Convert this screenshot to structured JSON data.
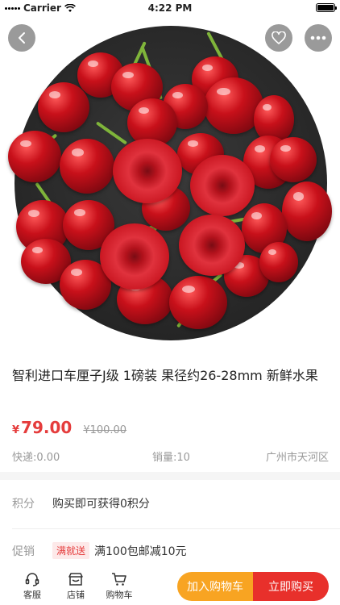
{
  "status_bar": {
    "carrier": "Carrier",
    "time": "4:22 PM"
  },
  "hero": {
    "icons": [
      "back-icon",
      "heart-icon",
      "more-icon"
    ]
  },
  "product": {
    "title": "智利进口车厘子J级 1磅装 果径约26-28mm 新鲜水果",
    "currency": "¥",
    "price": "79.00",
    "original_price": "¥100.00",
    "shipping": "快递:0.00",
    "sales": "销量:10",
    "location": "广州市天河区"
  },
  "points": {
    "label": "积分",
    "value": "购买即可获得0积分"
  },
  "promotion": {
    "label": "促销",
    "tag": "满就送",
    "value": "满100包邮减10元"
  },
  "bottom_bar": {
    "service_label": "客服",
    "shop_label": "店铺",
    "cart_label": "购物车",
    "add_to_cart": "加入购物车",
    "buy_now": "立即购买"
  },
  "colors": {
    "price_red": "#e53c3c",
    "cart_orange": "#f8a422",
    "buy_red": "#e8302b"
  }
}
